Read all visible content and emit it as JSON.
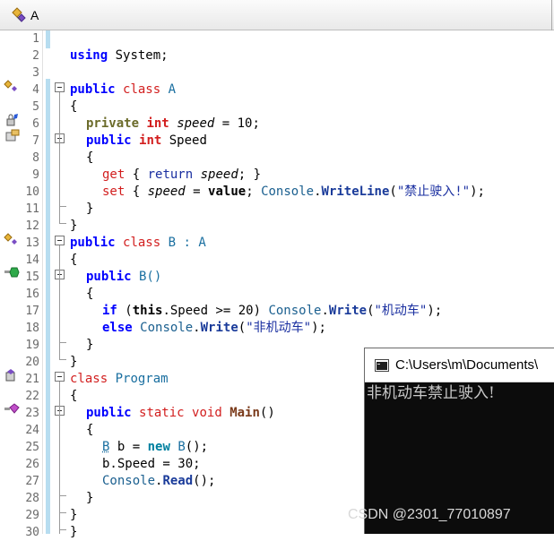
{
  "header": {
    "class_name": "A"
  },
  "line_numbers": [
    "1",
    "2",
    "3",
    "4",
    "5",
    "6",
    "7",
    "8",
    "9",
    "10",
    "11",
    "12",
    "13",
    "14",
    "15",
    "16",
    "17",
    "18",
    "19",
    "20",
    "21",
    "22",
    "23",
    "24",
    "25",
    "26",
    "27",
    "28",
    "29",
    "30"
  ],
  "code": {
    "l2": [
      "using",
      " System;"
    ],
    "l4": [
      "public",
      " ",
      "class",
      " A"
    ],
    "l5": [
      "{"
    ],
    "l6": [
      "private",
      " ",
      "int",
      " ",
      "speed",
      " = 10;"
    ],
    "l7": [
      "public",
      " ",
      "int",
      " Speed"
    ],
    "l8": [
      "{"
    ],
    "l9": [
      "get",
      " { ",
      "return",
      " ",
      "speed",
      "; }"
    ],
    "l10": [
      "set",
      " { ",
      "speed",
      " = ",
      "value",
      "; ",
      "Console",
      ".",
      "WriteLine",
      "(",
      "\"禁止驶入!\"",
      ");"
    ],
    "l11": [
      "}"
    ],
    "l12": [
      "}"
    ],
    "l13": [
      "public",
      " ",
      "class",
      " B : A"
    ],
    "l14": [
      "{"
    ],
    "l15": [
      "public",
      " B()"
    ],
    "l16": [
      "{"
    ],
    "l17": [
      "if",
      " (",
      "this",
      ".Speed >= 20) ",
      "Console",
      ".",
      "Write",
      "(",
      "\"机动车\"",
      ");"
    ],
    "l18": [
      "else",
      " ",
      "Console",
      ".",
      "Write",
      "(",
      "\"非机动车\"",
      ");"
    ],
    "l19": [
      "}"
    ],
    "l20": [
      "}"
    ],
    "l21": [
      "class",
      " Program"
    ],
    "l22": [
      "{"
    ],
    "l23": [
      "public",
      " ",
      "static",
      " ",
      "void",
      " ",
      "Main",
      "()"
    ],
    "l24": [
      "{"
    ],
    "l25": [
      "B",
      " b = ",
      "new",
      " ",
      "B",
      "();"
    ],
    "l26": [
      "b.Speed = 30;"
    ],
    "l27": [
      "Console",
      ".",
      "Read",
      "();"
    ],
    "l28": [
      "}"
    ],
    "l29": [
      "}"
    ],
    "l30": [
      "}"
    ]
  },
  "console": {
    "title": "C:\\Users\\m\\Documents\\",
    "output": "非机动车禁止驶入!"
  },
  "watermark": "CSDN @2301_77010897"
}
